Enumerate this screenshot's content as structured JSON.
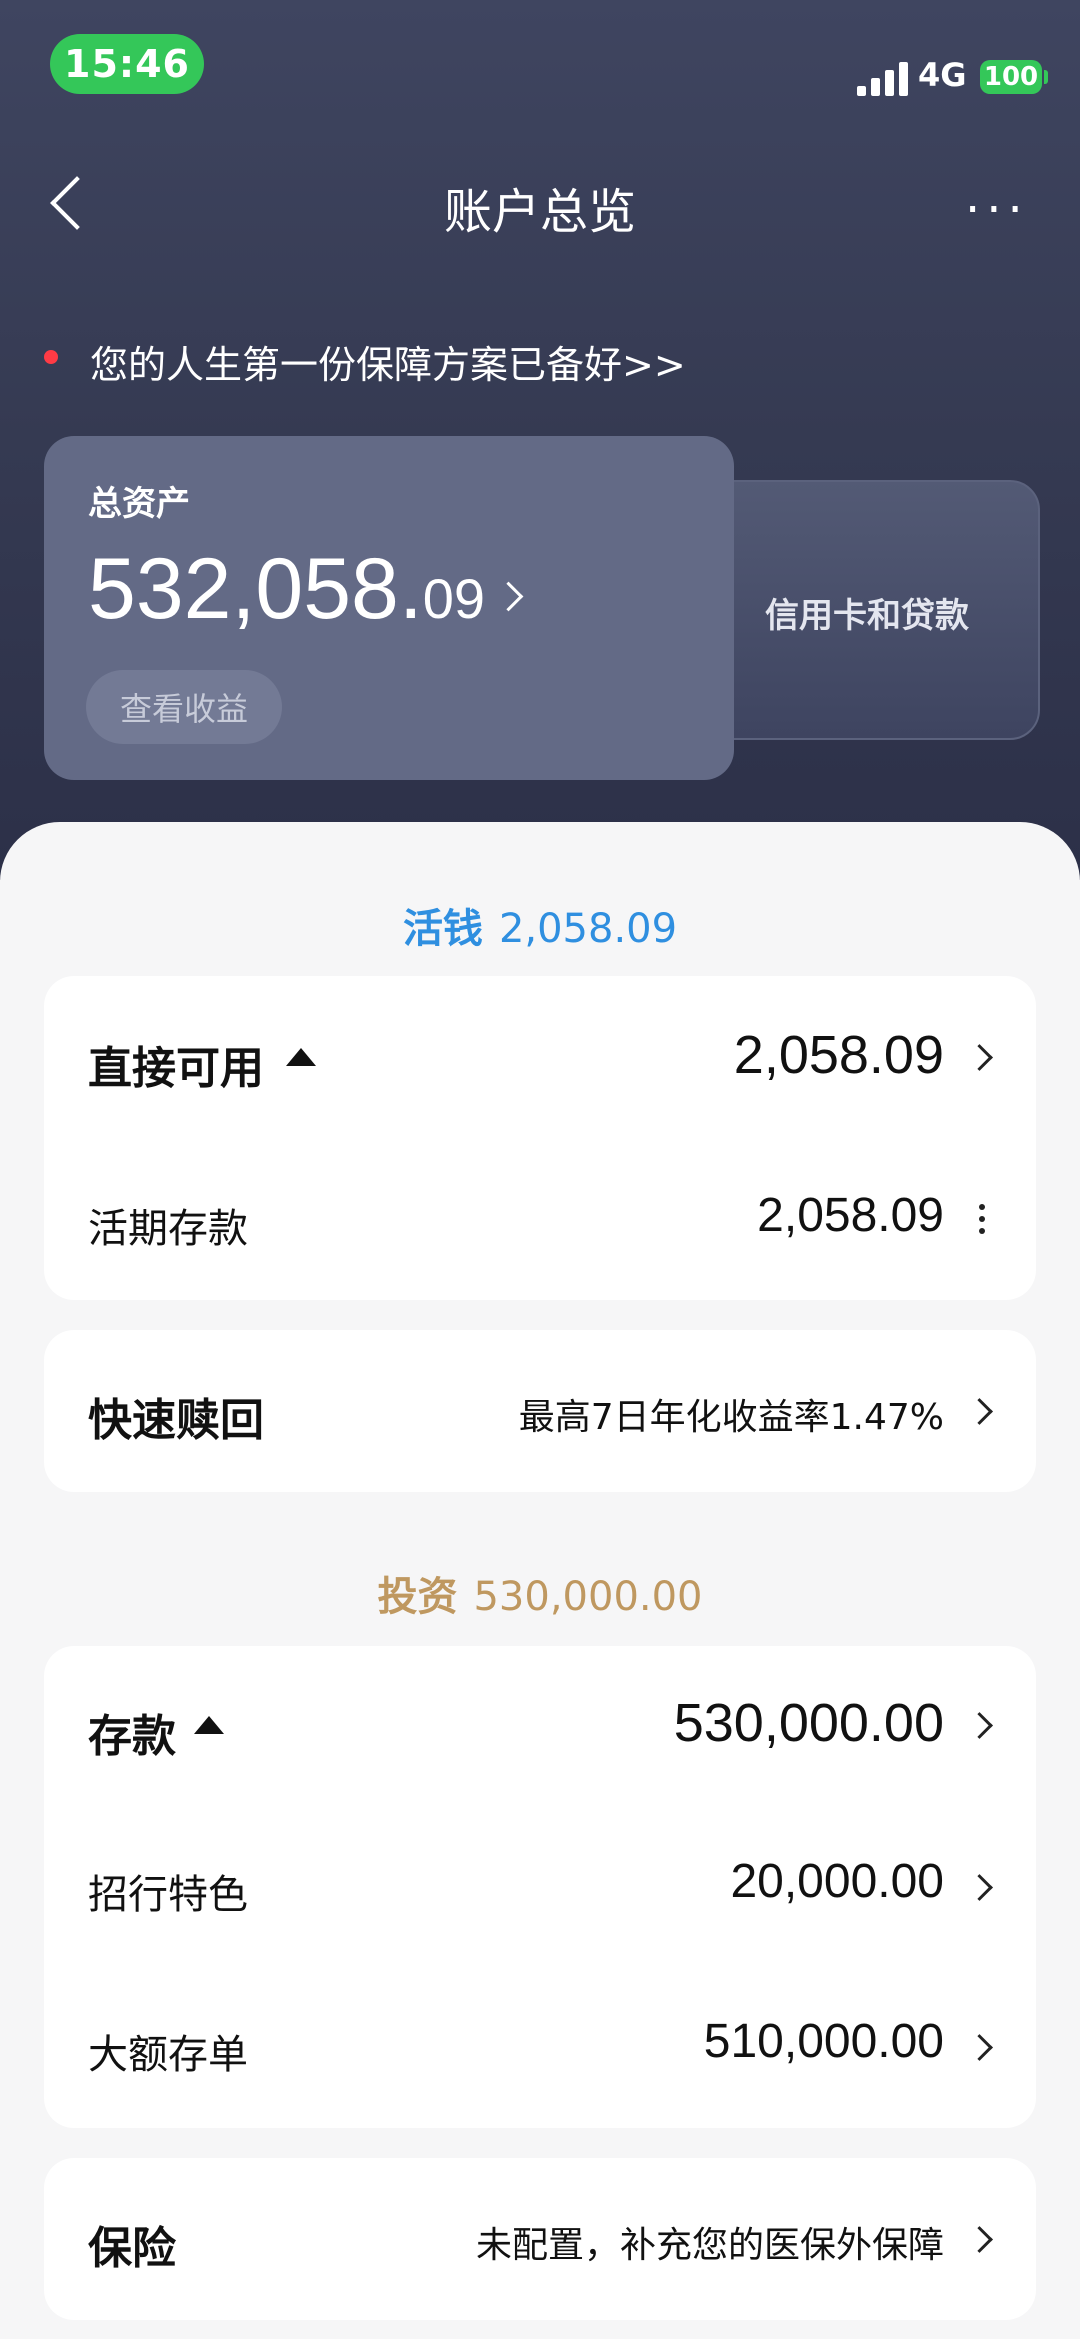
{
  "status_bar": {
    "time": "15:46",
    "network": "4G",
    "battery": "100"
  },
  "nav": {
    "title": "账户总览",
    "more": "···"
  },
  "promo": {
    "text": "您的人生第一份保障方案已备好>>"
  },
  "assets": {
    "label": "总资产",
    "amount_int": "532,058.",
    "amount_dec": "09",
    "earnings_button": "查看收益"
  },
  "credit": {
    "label": "信用卡和贷款"
  },
  "liquid": {
    "label": "活钱",
    "total": "2,058.09",
    "available": {
      "label": "直接可用",
      "value": "2,058.09"
    },
    "demand_deposit": {
      "label": "活期存款",
      "value": "2,058.09"
    },
    "quick_redeem": {
      "label": "快速赎回",
      "desc": "最高7日年化收益率1.47%"
    }
  },
  "invest": {
    "label": "投资",
    "total": "530,000.00",
    "deposits": {
      "label": "存款",
      "value": "530,000.00"
    },
    "featured": {
      "label": "招行特色",
      "value": "20,000.00"
    },
    "large_cd": {
      "label": "大额存单",
      "value": "510,000.00"
    },
    "insurance": {
      "label": "保险",
      "desc": "未配置，补充您的医保外保障"
    }
  },
  "colors": {
    "liquid_accent": "#2f8fe0",
    "invest_accent": "#bf9860",
    "status_green": "#34c759"
  }
}
